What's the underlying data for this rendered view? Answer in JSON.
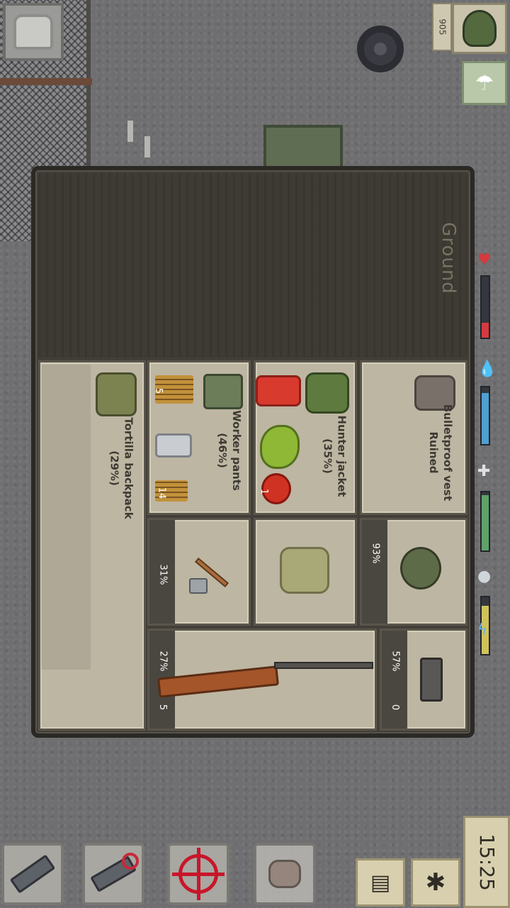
{
  "hud": {
    "counter": "905",
    "clock": "15:25",
    "icons": [
      "heart-icon",
      "water-drop-icon",
      "bone-icon",
      "lightning-icon"
    ],
    "stats": {
      "health": 0.25,
      "thirst": 0.9,
      "hunger": 0.95,
      "energy": 0.85
    }
  },
  "inventory": {
    "ground_label": "Ground",
    "containers": [
      {
        "label": "Tortilla backpack\n(29%)",
        "icon": "backpack-icon"
      },
      {
        "label": "Worker pants\n(46%)",
        "icon": "pants-icon"
      },
      {
        "label": "Hunter jacket\n(35%)",
        "icon": "jacket-icon"
      },
      {
        "label": "Bulletproof vest\nRuined",
        "icon": "vest-icon"
      }
    ],
    "items": {
      "ammo_5": "5",
      "ammo_14": "14",
      "tomato": "1"
    },
    "equipment": {
      "axe_durability": "31%",
      "helmet_durability": "93%",
      "rifle_durability": "27%",
      "rifle_ammo": "5",
      "pistol_durability": "57%",
      "pistol_ammo": "0"
    }
  },
  "toolbar": {
    "buttons": [
      "shoot-grenade-button",
      "swap-weapon-button",
      "aim-button",
      "pickup-button"
    ]
  },
  "colors": {
    "panel_bg": "#433f38",
    "cell_bg": "#bdb6a2",
    "health": "#d43a3f",
    "thirst": "#4f9fd1",
    "hunger": "#5fa26a",
    "energy": "#d0c25a"
  }
}
